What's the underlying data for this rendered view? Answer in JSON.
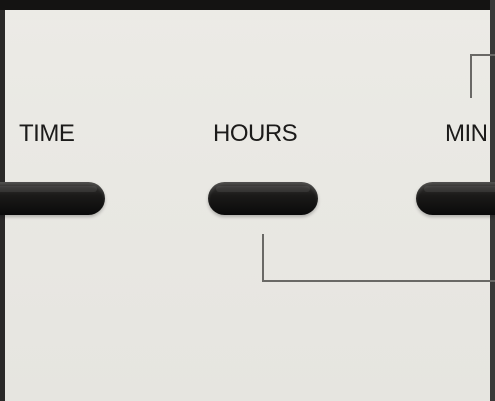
{
  "panel": {
    "labels": {
      "time": "TIME",
      "hours": "HOURS",
      "min": "MIN"
    },
    "colors": {
      "panel_background": "#ecebe6",
      "label_text": "#1c1b1a",
      "key_body": "#141312",
      "bracket_line": "#6a6966"
    }
  }
}
